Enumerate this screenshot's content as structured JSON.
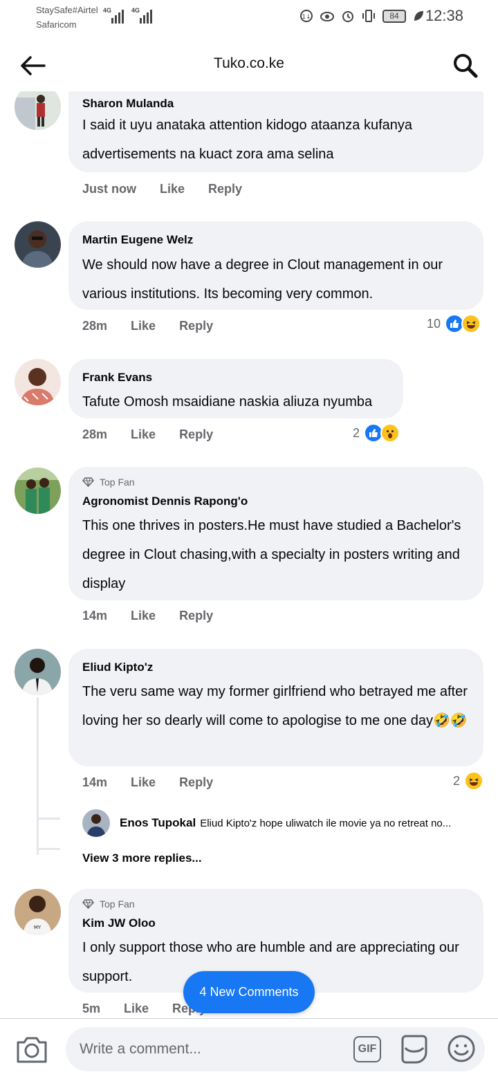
{
  "status_bar": {
    "carrier_1": "StaySafe#Airtel",
    "carrier_2": "Safaricom",
    "network_1": "4G",
    "network_2": "4G",
    "battery": "84",
    "time": "12:38"
  },
  "header": {
    "title": "Tuko.co.ke"
  },
  "comments": [
    {
      "name": "Sharon Mulanda",
      "text": "I said it uyu anataka attention kidogo ataanza kufanya advertisements na kuact zora ama selina",
      "time": "Just now",
      "like": "Like",
      "reply": "Reply"
    },
    {
      "name": "Martin Eugene Welz",
      "text": "We should now have a degree in Clout management in our various institutions. Its becoming very common.",
      "time": "28m",
      "like": "Like",
      "reply": "Reply",
      "reaction_count": "10"
    },
    {
      "name": "Frank Evans",
      "text": "Tafute Omosh msaidiane naskia aliuza nyumba",
      "time": "28m",
      "like": "Like",
      "reply": "Reply",
      "reaction_count": "2"
    },
    {
      "badge": "Top Fan",
      "name": "Agronomist Dennis Rapong'o",
      "text": "This one thrives in posters.He must have studied a Bachelor's degree in Clout chasing,with a specialty in posters writing and display",
      "time": "14m",
      "like": "Like",
      "reply": "Reply"
    },
    {
      "name": "Eliud Kipto'z",
      "text": "The veru same way my former girlfriend who betrayed me after loving her so dearly will come to apologise to me one day",
      "text_emoji": "🤣🤣",
      "time": "14m",
      "like": "Like",
      "reply": "Reply",
      "reaction_count": "2",
      "reply_preview": {
        "name": "Enos Tupokal",
        "text": "Eliud Kipto'z hope uliwatch ile movie ya no retreat no..."
      },
      "view_more": "View 3 more replies..."
    },
    {
      "badge": "Top Fan",
      "name": "Kim JW Oloo",
      "text": "I only support those who are humble and are appreciating our support.",
      "time": "5m",
      "like": "Like",
      "reply": "Reply"
    }
  ],
  "new_comments_label": "4 New Comments",
  "composer": {
    "placeholder": "Write a comment...",
    "gif_label": "GIF"
  },
  "colors": {
    "accent": "#1877f2",
    "bubble": "#f0f2f5",
    "meta_text": "#65676b"
  }
}
